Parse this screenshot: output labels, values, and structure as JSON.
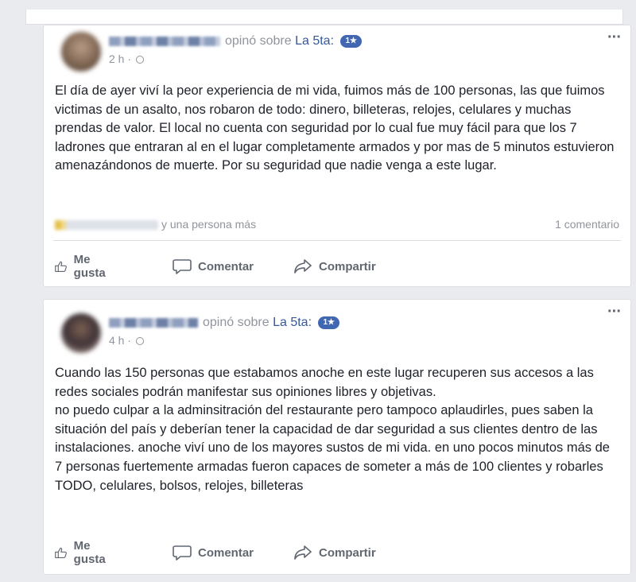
{
  "posts": [
    {
      "verb": "opinó sobre",
      "page": "La 5ta:",
      "rating": "1★",
      "time": "2 h ·",
      "text": "El día de ayer viví la peor experiencia de mi vida, fuimos más de 100 personas, las que fuimos victimas de un asalto, nos robaron de todo: dinero, billeteras, relojes, celulares y muchas prendas de valor. El local no cuenta con seguridad por lo cual fue muy fácil para que los 7 ladrones que entraran al en el lugar completamente armados y por mas de 5 minutos estuvieron amenazándonos de muerte. Por su seguridad que nadie venga a este lugar.",
      "reactions": "y una persona más",
      "comments": "1 comentario",
      "actions": {
        "like": "Me gusta",
        "comment": "Comentar",
        "share": "Compartir"
      }
    },
    {
      "verb": "opinó sobre",
      "page": "La 5ta:",
      "rating": "1★",
      "time": "4 h ·",
      "text_lines": [
        "Cuando las 150 personas que estabamos anoche en este lugar recuperen sus accesos a las redes sociales podrán manifestar sus opiniones libres y objetivas.",
        "no puedo culpar a la adminsitración del restaurante pero tampoco aplaudirles, pues saben la situación del país y deberían tener la capacidad de dar seguridad a sus clientes dentro de las instalaciones. anoche viví uno de los mayores sustos de mi vida. en uno pocos minutos más de 7 personas fuertemente armadas fueron capaces de someter a más de 100 clientes y robarles TODO, celulares, bolsos, relojes, billeteras"
      ],
      "actions": {
        "like": "Me gusta",
        "comment": "Comentar",
        "share": "Compartir"
      }
    }
  ],
  "colors": {
    "link": "#365899",
    "badge": "#4267b2",
    "meta": "#90949c"
  },
  "icons": [
    "globe-icon",
    "more-icon",
    "like-icon",
    "comment-icon",
    "share-icon"
  ]
}
